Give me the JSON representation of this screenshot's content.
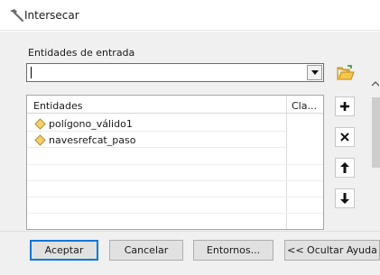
{
  "window": {
    "title": "Intersecar",
    "icon": "hammer-icon"
  },
  "input": {
    "label": "Entidades de entrada",
    "value": ""
  },
  "grid": {
    "columns": [
      "Entidades",
      "Cla..."
    ],
    "rows": [
      {
        "name": "polígono_válido1",
        "icon": "polygon-layer-icon"
      },
      {
        "name": "navesrefcat_paso",
        "icon": "polygon-layer-icon"
      }
    ]
  },
  "side_buttons": [
    "add-icon",
    "remove-icon",
    "move-up-icon",
    "move-down-icon"
  ],
  "buttons": {
    "ok": "Aceptar",
    "cancel": "Cancelar",
    "environments": "Entornos...",
    "hide_help": "<< Ocultar Ayuda"
  },
  "colors": {
    "accent": "#0078d7",
    "layer_icon": "#e9c46a"
  }
}
